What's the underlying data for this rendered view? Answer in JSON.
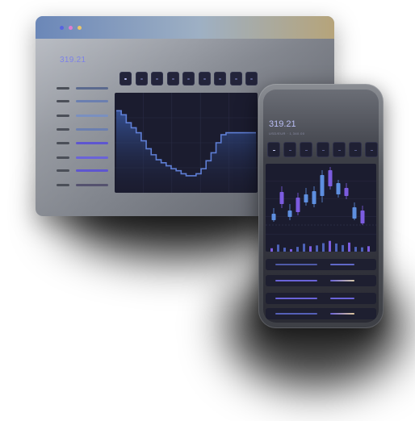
{
  "desktop": {
    "window_dots": [
      "#5864e0",
      "#e07bd0",
      "#e9c56a"
    ],
    "price": "319.21",
    "timeframe_count_note": "",
    "accent": "#5e62d9",
    "line_color": "#5f7fd6",
    "area_color": "#2c3f77"
  },
  "mobile": {
    "price": "319.21",
    "subtitle": "USD/EUR · 1,340.00",
    "candle_up": "#5e8fe0",
    "candle_down": "#7c5ce0"
  },
  "chart_data": [
    {
      "type": "line",
      "x": [
        0,
        1,
        2,
        3,
        4,
        5,
        6,
        7,
        8,
        9,
        10,
        11,
        12,
        13,
        14,
        15,
        16,
        17,
        18,
        19,
        20,
        21,
        22,
        23,
        24,
        25,
        26,
        27,
        28
      ],
      "y": [
        82,
        78,
        70,
        65,
        60,
        52,
        44,
        38,
        33,
        30,
        27,
        24,
        22,
        19,
        17,
        17,
        19,
        24,
        32,
        40,
        50,
        58,
        60,
        60,
        60,
        60,
        60,
        60,
        60
      ],
      "title": "",
      "xlabel": "",
      "ylabel": "",
      "ylim": [
        0,
        100
      ],
      "grid": true
    },
    {
      "type": "bar",
      "categories": [
        "1",
        "2",
        "3",
        "4",
        "5",
        "6",
        "7",
        "8",
        "9",
        "10",
        "11",
        "12",
        "13",
        "14",
        "15",
        "16"
      ],
      "series": [
        {
          "values": [
            30,
            62,
            35,
            22,
            42,
            70,
            48,
            55,
            75,
            95,
            72,
            58,
            80,
            42,
            38,
            48
          ]
        }
      ],
      "ylim": [
        0,
        100
      ],
      "grid": true
    }
  ]
}
